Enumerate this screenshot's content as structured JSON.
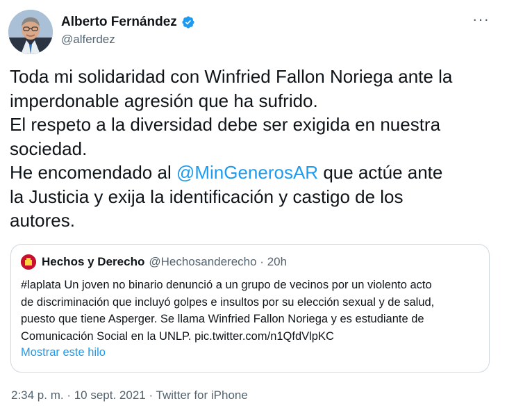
{
  "author": {
    "name": "Alberto Fernández",
    "handle": "@alferdez"
  },
  "tweet": {
    "line1": "Toda mi solidaridad con Winfried Fallon Noriega ante la",
    "line2": "imperdonable agresión que ha sufrido.",
    "line3": "El respeto a la diversidad debe ser exigida en nuestra",
    "line4": "sociedad.",
    "line5_before": "He encomendado al ",
    "line5_mention": "@MinGenerosAR",
    "line5_after": " que actúe ante",
    "line6": "la Justicia y exija la identificación y castigo de los",
    "line7": "autores."
  },
  "quote": {
    "name": "Hechos y Derecho",
    "meta": "@Hechosanderecho · 20h",
    "line1": "#laplata Un joven no binario denunció a un grupo de vecinos por un violento acto",
    "line2": "de discriminación que incluyó golpes e insultos por su elección sexual y de salud,",
    "line3": "puesto que tiene Asperger. Se llama Winfried Fallon Noriega  y es estudiante de",
    "line4": "Comunicación Social en la UNLP. pic.twitter.com/n1QfdVlpKC",
    "show_thread": "Mostrar este hilo"
  },
  "footer": {
    "text": "2:34 p. m. · 10 sept. 2021 · Twitter for iPhone"
  },
  "colors": {
    "link": "#1d9bf0",
    "muted": "#536471",
    "border": "#cfd9de"
  },
  "icons": [
    "verified-badge-icon",
    "more-options-icon"
  ]
}
